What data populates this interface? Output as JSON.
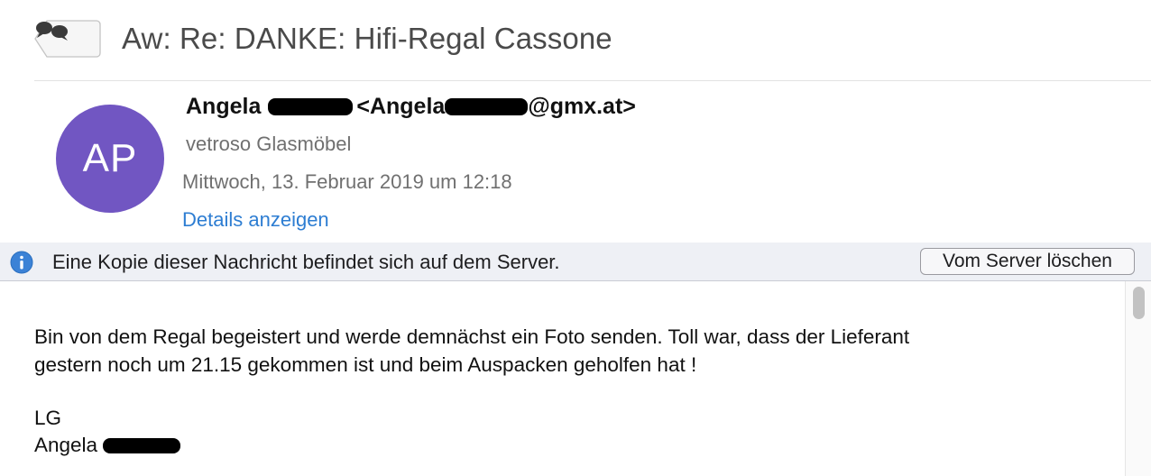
{
  "header": {
    "subject": "Aw: Re: DANKE: Hifi-Regal Cassone",
    "back_button_icon": "conversation-bubbles-icon"
  },
  "sender": {
    "avatar_initials": "AP",
    "avatar_color": "#7156c2",
    "first_name": "Angela",
    "email_prefix": "<Angela",
    "email_suffix": "@gmx.at>",
    "organization": "vetroso Glasmöbel",
    "date": "Mittwoch, 13. Februar 2019 um 12:18",
    "details_link": "Details anzeigen"
  },
  "banner": {
    "icon": "info-icon",
    "text": "Eine Kopie dieser Nachricht befindet sich auf dem Server.",
    "button_label": "Vom Server löschen"
  },
  "message": {
    "line1": "Bin von dem Regal begeistert und werde demnächst ein Foto senden. Toll war, dass der Lieferant",
    "line2": "gestern noch um 21.15 gekommen ist und beim Auspacken geholfen hat !",
    "greeting": "LG",
    "signature_name": "Angela"
  },
  "colors": {
    "link": "#2d7dd2",
    "banner_bg": "#eef0f5",
    "info_icon": "#3b82d6"
  }
}
